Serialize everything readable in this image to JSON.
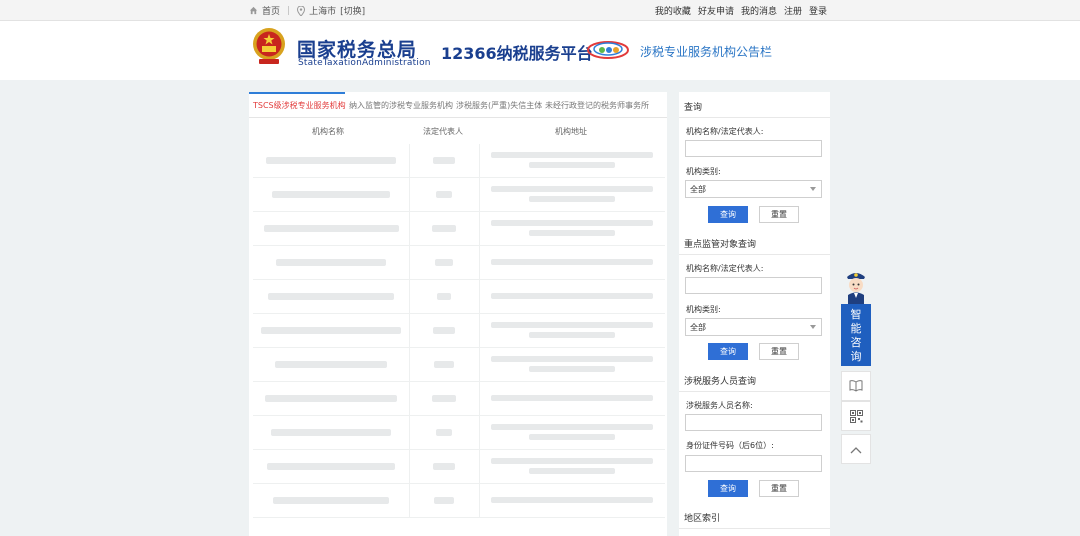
{
  "topbar": {
    "home": "首页",
    "city": "上海市",
    "switch": "[切换]",
    "links": [
      "我的收藏",
      "好友申请",
      "我的消息",
      "注册",
      "登录"
    ]
  },
  "header": {
    "logo_cn": "国家税务总局",
    "logo_en": "StateTaxationAdministration",
    "platform": "12366纳税服务平台",
    "board_title": "涉税专业服务机构公告栏"
  },
  "tabs": [
    {
      "label": "TSCS级涉税专业服务机构",
      "active": true
    },
    {
      "label": "纳入监管的涉税专业服务机构",
      "active": false
    },
    {
      "label": "涉税服务(严重)失信主体",
      "active": false
    },
    {
      "label": "未经行政登记的税务师事务所",
      "active": false
    }
  ],
  "table": {
    "columns": [
      "机构名称",
      "法定代表人",
      "机构地址"
    ]
  },
  "query1": {
    "title": "查询",
    "name_label": "机构名称/法定代表人:",
    "name_value": "",
    "type_label": "机构类别:",
    "type_value": "全部",
    "query_btn": "查询",
    "reset_btn": "重置"
  },
  "query2": {
    "title": "重点监管对象查询",
    "name_label": "机构名称/法定代表人:",
    "name_value": "",
    "type_label": "机构类别:",
    "type_value": "全部",
    "query_btn": "查询",
    "reset_btn": "重置"
  },
  "query3": {
    "title": "涉税服务人员查询",
    "name_label": "涉税服务人员名称:",
    "name_value": "",
    "id_label": "身份证件号码（后6位）:",
    "id_value": "",
    "query_btn": "查询",
    "reset_btn": "重置"
  },
  "region": {
    "title": "地区索引"
  },
  "float": {
    "consult": "智能咨询"
  }
}
